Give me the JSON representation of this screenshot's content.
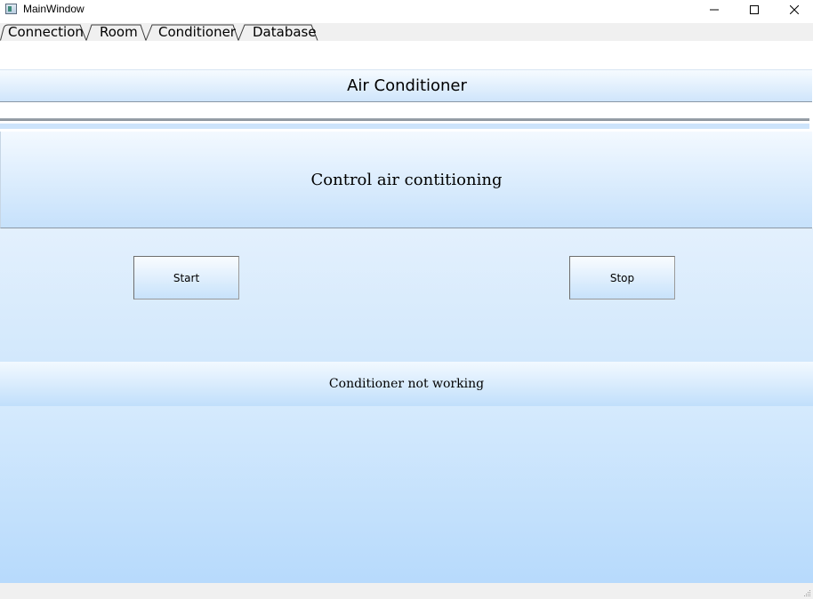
{
  "window": {
    "title": "MainWindow"
  },
  "tabs": [
    {
      "label": "Connection"
    },
    {
      "label": "Room"
    },
    {
      "label": "Conditioner"
    },
    {
      "label": "Database"
    }
  ],
  "active_tab": "Conditioner",
  "header": {
    "title": "Air Conditioner"
  },
  "control": {
    "title": "Control air contitioning",
    "start_label": "Start",
    "stop_label": "Stop"
  },
  "status": {
    "text": "Conditioner not working"
  },
  "colors": {
    "panel_gradient_top": "#f3f9ff",
    "panel_gradient_bottom": "#b7dafc",
    "tab_bar": "#f0f0f0"
  },
  "icons": {
    "app": "app-window-icon",
    "minimize": "minimize-icon",
    "maximize": "maximize-icon",
    "close": "close-icon",
    "grip": "size-grip-icon"
  }
}
